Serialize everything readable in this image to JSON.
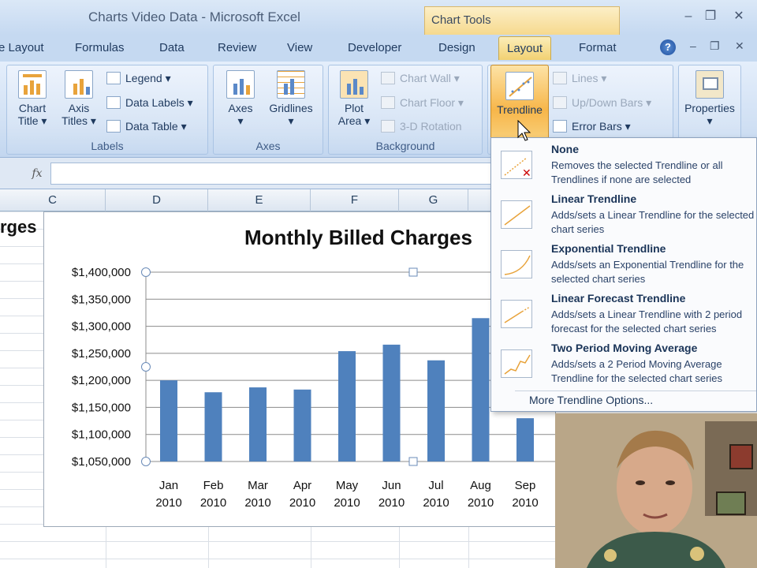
{
  "window": {
    "title": "Charts Video Data - Microsoft Excel",
    "context_tab_group": "Chart Tools",
    "controls": [
      "–",
      "❐",
      "✕"
    ],
    "doc_controls": [
      "–",
      "❐",
      "✕"
    ]
  },
  "tabs": [
    {
      "label": "e Layout"
    },
    {
      "label": "Formulas"
    },
    {
      "label": "Data"
    },
    {
      "label": "Review"
    },
    {
      "label": "View"
    },
    {
      "label": "Developer"
    },
    {
      "label": "Design"
    },
    {
      "label": "Layout",
      "active": true
    },
    {
      "label": "Format"
    }
  ],
  "ribbon": {
    "labels_group": {
      "label": "Labels",
      "chart_title": [
        "Chart",
        "Title ▾"
      ],
      "axis_titles": [
        "Axis",
        "Titles ▾"
      ],
      "legend": "Legend ▾",
      "data_labels": "Data Labels ▾",
      "data_table": "Data Table ▾"
    },
    "axes_group": {
      "label": "Axes",
      "axes": [
        "Axes",
        "▾"
      ],
      "gridlines": [
        "Gridlines",
        "▾"
      ]
    },
    "background_group": {
      "label": "Background",
      "plot_area": [
        "Plot",
        "Area ▾"
      ],
      "chart_wall": "Chart Wall ▾",
      "chart_floor": "Chart Floor ▾",
      "rotation": "3-D Rotation"
    },
    "analysis_group": {
      "trendline": "Trendline",
      "lines": "Lines ▾",
      "updown_bars": "Up/Down Bars ▾",
      "error_bars": "Error Bars ▾"
    },
    "properties": [
      "Properties",
      "▾"
    ]
  },
  "formula_bar": {
    "fx": "fx",
    "value": ""
  },
  "columns": [
    "C",
    "D",
    "E",
    "F",
    "G"
  ],
  "cells": {
    "left_fragment": "rges"
  },
  "trendline_menu": {
    "items": [
      {
        "title": "None",
        "desc": "Removes the selected Trendline or all Trendlines if none are selected"
      },
      {
        "title": "Linear Trendline",
        "desc": "Adds/sets a Linear Trendline for the selected chart series"
      },
      {
        "title": "Exponential Trendline",
        "desc": "Adds/sets an Exponential Trendline for the selected chart series"
      },
      {
        "title": "Linear Forecast Trendline",
        "desc": "Adds/sets a Linear Trendline with 2 period forecast for the selected chart series"
      },
      {
        "title": "Two Period Moving Average",
        "desc": "Adds/sets a 2 Period Moving Average Trendline for the selected chart series"
      }
    ],
    "more": "More Trendline Options..."
  },
  "colors": {
    "bar": "#4f81bd",
    "accent": "#f7b64a"
  },
  "chart_data": {
    "type": "bar",
    "title": "Monthly Billed Charges",
    "categories": [
      [
        "Jan",
        "2010"
      ],
      [
        "Feb",
        "2010"
      ],
      [
        "Mar",
        "2010"
      ],
      [
        "Apr",
        "2010"
      ],
      [
        "May",
        "2010"
      ],
      [
        "Jun",
        "2010"
      ],
      [
        "Jul",
        "2010"
      ],
      [
        "Aug",
        "2010"
      ],
      [
        "Sep",
        "2010"
      ]
    ],
    "values": [
      1200000,
      1178000,
      1187000,
      1183000,
      1254000,
      1266000,
      1237000,
      1315000,
      1130000
    ],
    "yticks": [
      "$1,050,000",
      "$1,100,000",
      "$1,150,000",
      "$1,200,000",
      "$1,250,000",
      "$1,300,000",
      "$1,350,000",
      "$1,400,000"
    ],
    "ylim": [
      1050000,
      1400000
    ],
    "grid": true
  }
}
